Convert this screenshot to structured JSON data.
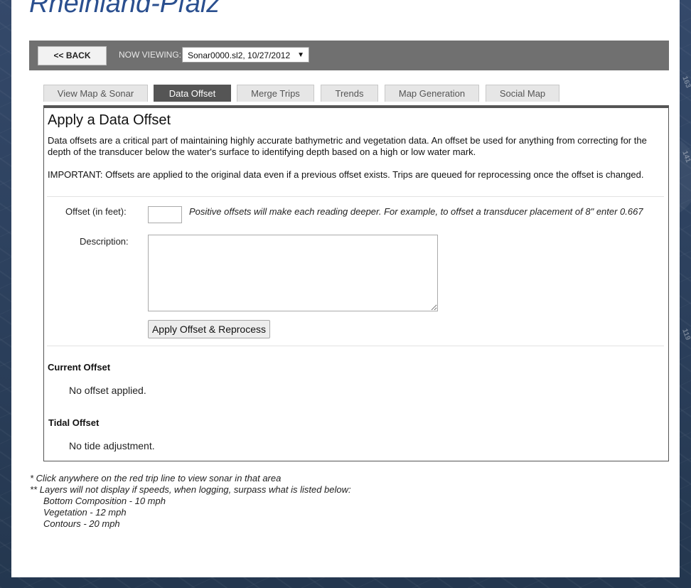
{
  "site": {
    "title": "Rheinland-Pfalz"
  },
  "toolbar": {
    "back_label": "<< BACK",
    "now_viewing_label": "NOW VIEWING:",
    "selected_trip": "Sonar0000.sl2, 10/27/2012"
  },
  "tabs": [
    {
      "label": "View Map & Sonar",
      "active": false
    },
    {
      "label": "Data Offset",
      "active": true
    },
    {
      "label": "Merge Trips",
      "active": false
    },
    {
      "label": "Trends",
      "active": false
    },
    {
      "label": "Map Generation",
      "active": false
    },
    {
      "label": "Social Map",
      "active": false
    }
  ],
  "panel": {
    "title": "Apply a Data Offset",
    "intro": "Data offsets are a critical part of maintaining highly accurate bathymetric and vegetation data. An offset be used for anything from correcting for the depth of the transducer below the water's surface to identifying depth based on a high or low water mark.",
    "important": "IMPORTANT: Offsets are applied to the original data even if a previous offset exists. Trips are queued for reprocessing once the offset is changed.",
    "offset_label": "Offset (in feet):",
    "offset_value": "",
    "offset_hint": "Positive offsets will make each reading deeper. For example, to offset a transducer placement of 8\" enter 0.667",
    "description_label": "Description:",
    "description_value": "",
    "apply_label": "Apply Offset & Reprocess",
    "current_offset_heading": "Current Offset",
    "current_offset_value": "No offset applied.",
    "tidal_offset_heading": "Tidal Offset",
    "tidal_offset_value": "No tide adjustment."
  },
  "notes": {
    "line1": "* Click anywhere on the red trip line to view sonar in that area",
    "line2": "** Layers will not display if speeds, when logging, surpass what is listed below:",
    "speeds": [
      "Bottom Composition - 10 mph",
      "Vegetation - 12 mph",
      "Contours - 20 mph"
    ]
  },
  "map_labels": [
    "163",
    "141",
    "119"
  ],
  "colors": {
    "toolbar_bg": "#707070",
    "active_tab": "#555555",
    "title_blue": "#2a4f8f",
    "page_bg": "#2b3f5c"
  }
}
